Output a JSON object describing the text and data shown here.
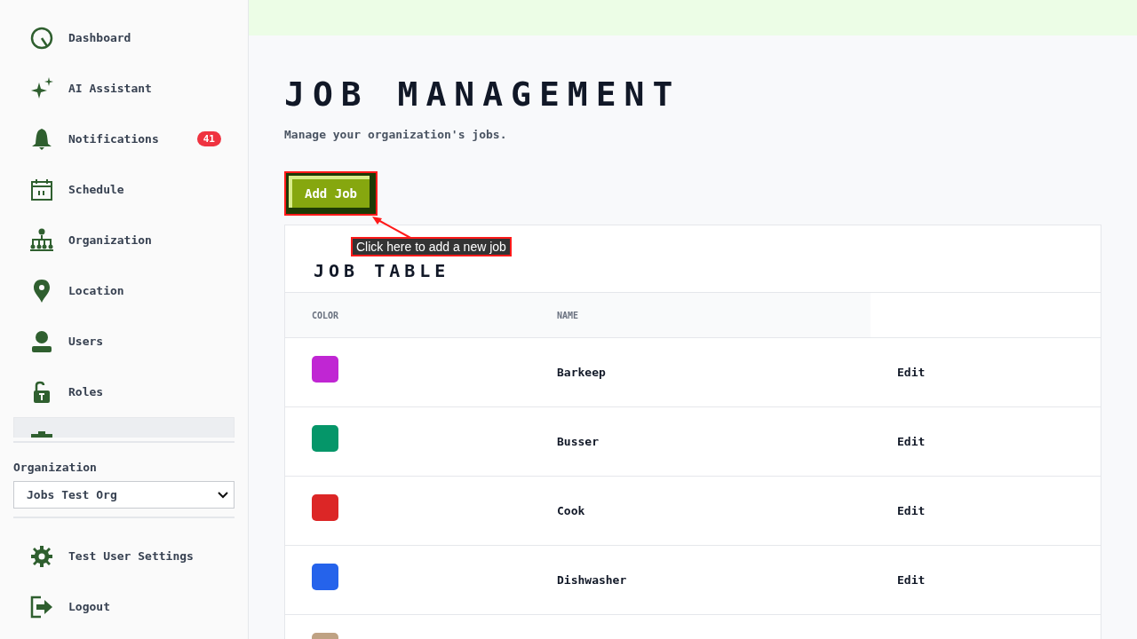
{
  "sidebar": {
    "items": [
      {
        "label": "Dashboard",
        "kind": "dashboard",
        "selected": false
      },
      {
        "label": "AI Assistant",
        "kind": "sparkle",
        "selected": false
      },
      {
        "label": "Notifications",
        "kind": "bell",
        "selected": false,
        "badge": "41"
      },
      {
        "label": "Schedule",
        "kind": "calendar",
        "selected": false
      },
      {
        "label": "Organization",
        "kind": "tree",
        "selected": false
      },
      {
        "label": "Location",
        "kind": "pin",
        "selected": false
      },
      {
        "label": "Users",
        "kind": "user",
        "selected": false
      },
      {
        "label": "Roles",
        "kind": "lock",
        "selected": false
      },
      {
        "kind": "briefcase",
        "selected": true
      }
    ],
    "organization": {
      "label": "Organization",
      "value": "Jobs Test Org"
    },
    "footer_items": [
      {
        "label": "Test User Settings",
        "kind": "gear"
      },
      {
        "label": "Logout",
        "kind": "logout"
      }
    ]
  },
  "page": {
    "title": "JOB MANAGEMENT",
    "subtitle": "Manage your organization's jobs.",
    "add_button": "Add Job",
    "tooltip": "Click here to add a new job"
  },
  "table": {
    "title": "JOB TABLE",
    "columns": [
      "COLOR",
      "NAME"
    ],
    "rows": [
      {
        "color": "#c026d3",
        "name": "Barkeep",
        "action": "Edit"
      },
      {
        "color": "#059669",
        "name": "Busser",
        "action": "Edit"
      },
      {
        "color": "#dc2626",
        "name": "Cook",
        "action": "Edit"
      },
      {
        "color": "#2563eb",
        "name": "Dishwasher",
        "action": "Edit"
      },
      {
        "color": "#bfa283"
      }
    ]
  }
}
